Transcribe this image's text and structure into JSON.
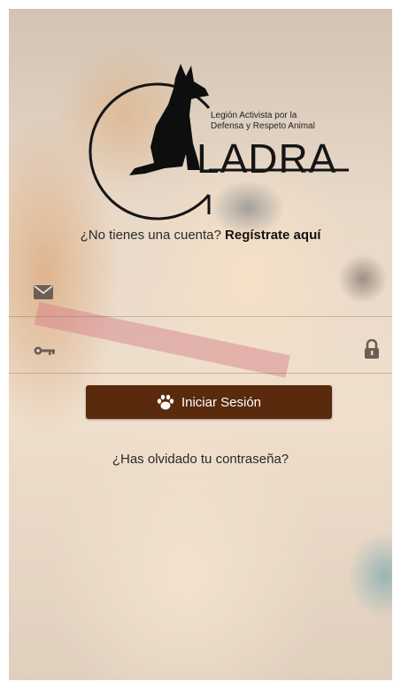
{
  "logo": {
    "subtitle_line1": "Legión Activista por la",
    "subtitle_line2": "Defensa y Respeto Animal",
    "wordmark": "LADRA"
  },
  "register": {
    "prompt": "¿No tienes una cuenta?",
    "link_label": "Regístrate aquí"
  },
  "form": {
    "email_value": "",
    "password_value": "",
    "login_button_label": "Iniciar Sesión"
  },
  "forgot_password_label": "¿Has olvidado tu contraseña?",
  "colors": {
    "button_bg": "#5a2a0c"
  },
  "icons": [
    "envelope-icon",
    "key-icon",
    "lock-icon",
    "paw-icon",
    "dog-silhouette-icon"
  ]
}
